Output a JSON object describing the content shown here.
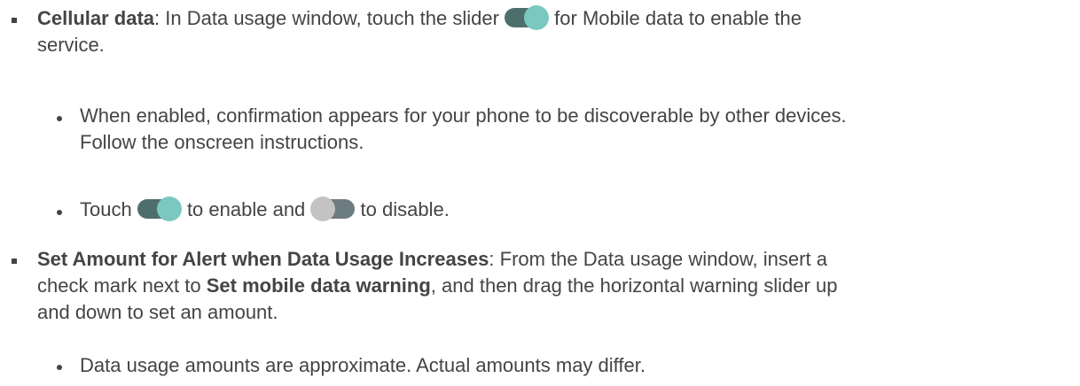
{
  "items": [
    {
      "label": "Cellular data",
      "text1": ": In Data usage window, touch the slider ",
      "text2": " for Mobile data to enable the",
      "text3": "service.",
      "subitems": [
        {
          "line1": "When enabled, confirmation appears for your phone to be discoverable by other devices.",
          "line2": "Follow the onscreen instructions."
        },
        {
          "text1": "Touch ",
          "text2": " to enable and ",
          "text3": " to disable."
        }
      ]
    },
    {
      "label": "Set Amount for Alert when Data Usage Increases",
      "text1": ": From the Data usage window, insert a",
      "text2": "check mark next to ",
      "label2": "Set mobile data warning",
      "text3": ", and then drag the horizontal warning slider up",
      "text4": "and down to set an amount.",
      "subitems": [
        {
          "line1": "Data usage amounts are approximate. Actual amounts may differ."
        }
      ]
    }
  ],
  "icons": {
    "toggle_on": "toggle-on-icon",
    "toggle_off": "toggle-off-icon"
  },
  "colors": {
    "text": "#444444",
    "toggle_on_track": "#4e6e6e",
    "toggle_on_knob": "#7bc8c1",
    "toggle_off_track": "#6d7b82",
    "toggle_off_knob": "#c3c3c3"
  }
}
